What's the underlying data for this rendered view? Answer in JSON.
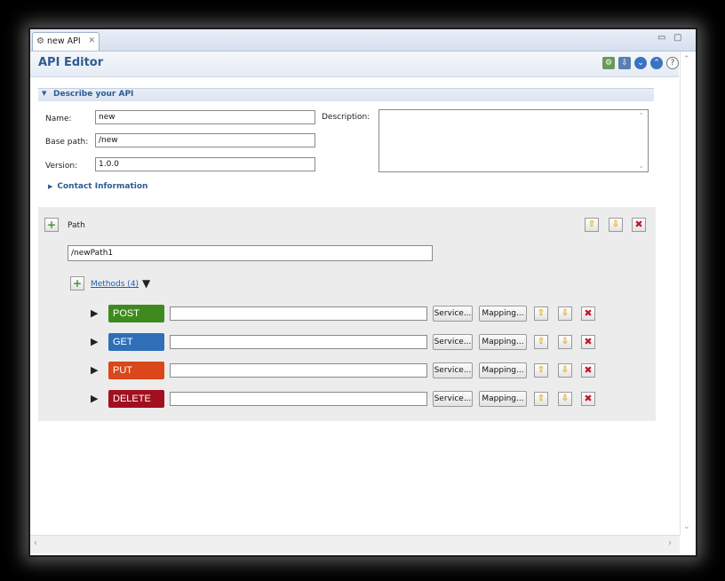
{
  "tab": {
    "title": "new API",
    "icon": "gear-icon",
    "close": "✕"
  },
  "editor": {
    "title": "API Editor"
  },
  "section": {
    "title": "Describe your API"
  },
  "form": {
    "name_label": "Name:",
    "name_value": "new",
    "basepath_label": "Base path:",
    "basepath_value": "/new",
    "version_label": "Version:",
    "version_value": "1.0.0",
    "description_label": "Description:",
    "description_value": ""
  },
  "contact": {
    "label": "Contact Information"
  },
  "path": {
    "label": "Path",
    "value": "/newPath1"
  },
  "methods": {
    "link_label": "Methods (4)",
    "rows": [
      {
        "name": "POST",
        "color": "#3f8a1f",
        "value": ""
      },
      {
        "name": "GET",
        "color": "#2f6fb8",
        "value": ""
      },
      {
        "name": "PUT",
        "color": "#d9471a",
        "value": ""
      },
      {
        "name": "DELETE",
        "color": "#a0101f",
        "value": ""
      }
    ],
    "service_label": "Service...",
    "mapping_label": "Mapping..."
  },
  "colors": {
    "accent": "#2f5b92",
    "link": "#1f5fb5"
  }
}
